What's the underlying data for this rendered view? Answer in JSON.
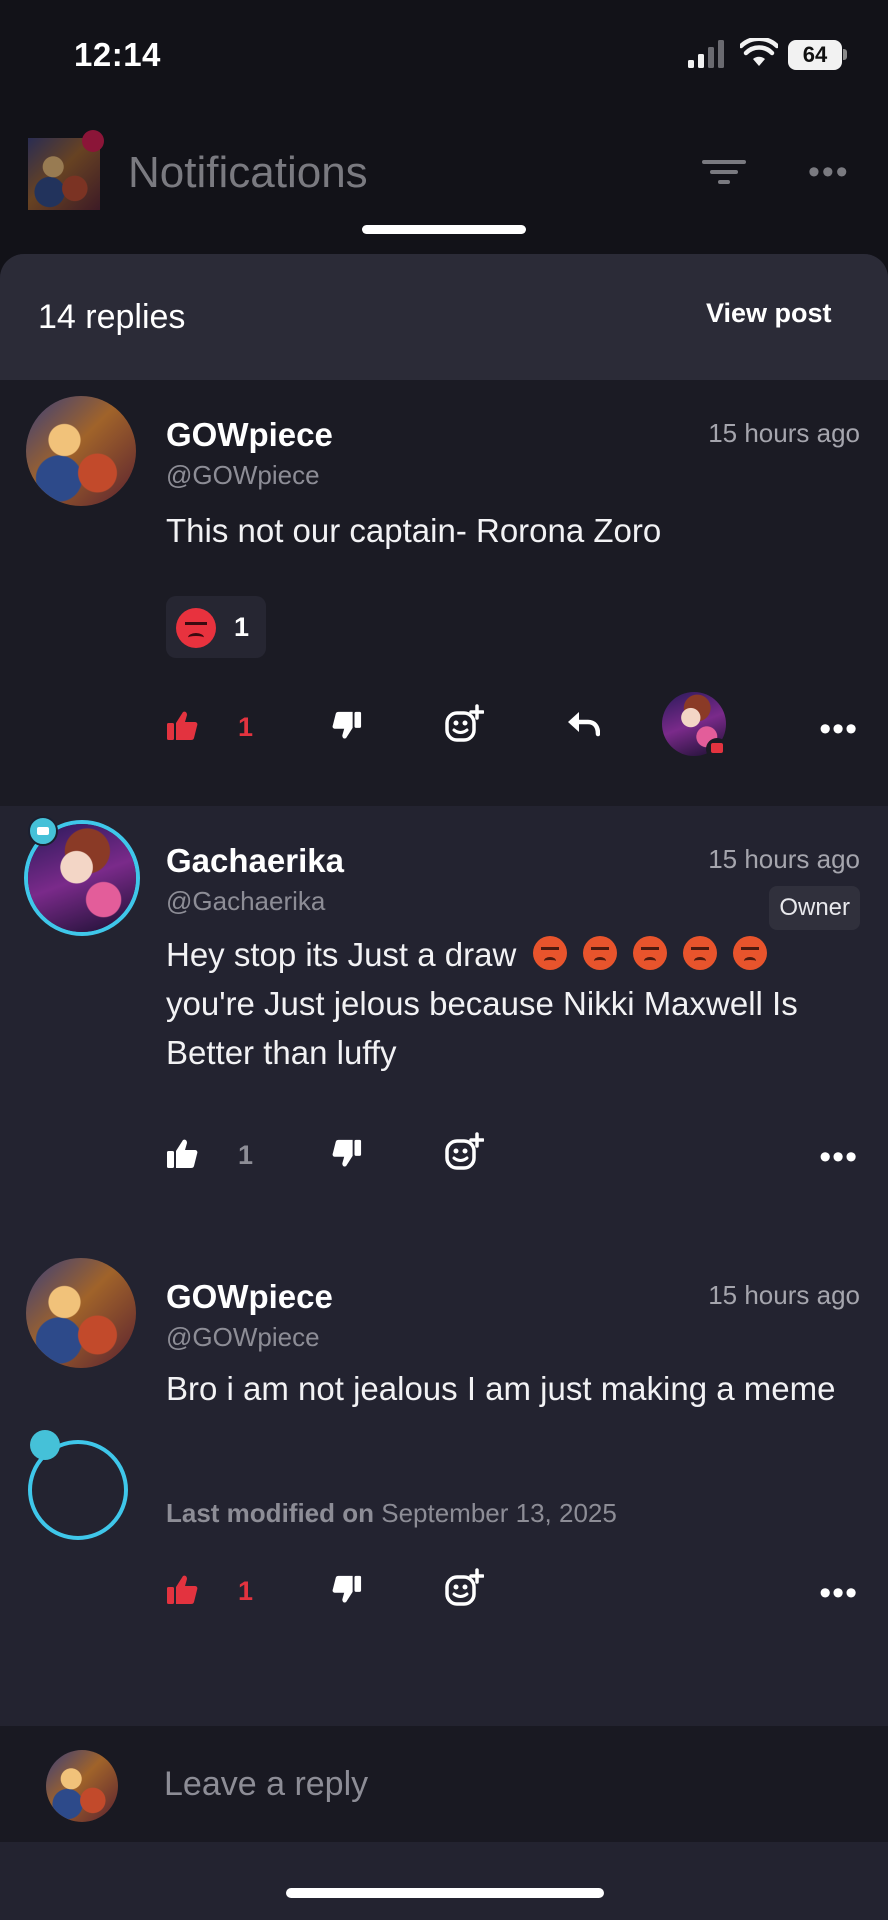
{
  "status_bar": {
    "time": "12:14",
    "battery": "64"
  },
  "background_header": {
    "title": "Notifications"
  },
  "sheet": {
    "reply_count": "14 replies",
    "view_post_label": "View post"
  },
  "comments": [
    {
      "author": "GOWpiece",
      "handle": "@GOWpiece",
      "time": "15 hours ago",
      "body": "This not our captain- Rorona Zoro",
      "reaction_count": "1",
      "like_count": "1",
      "liked": true
    },
    {
      "author": "Gachaerika",
      "handle": "@Gachaerika",
      "time": "15 hours ago",
      "badge": "Owner",
      "body_start": "Hey stop its Just a draw",
      "body_end": "you're Just jelous because Nikki Maxwell Is Better than luffy",
      "like_count": "1",
      "liked": false
    },
    {
      "author": "GOWpiece",
      "handle": "@GOWpiece",
      "time": "15 hours ago",
      "body": "Bro i am not jealous I am just making a meme",
      "modified_label": "Last modified on",
      "modified_date": "September 13, 2025",
      "like_count": "1",
      "liked": true
    }
  ],
  "reply_bar": {
    "placeholder": "Leave a reply"
  },
  "colors": {
    "accent_red": "#e3333f",
    "sheet_bg": "#232330",
    "ring_cyan": "#3fc7ea"
  },
  "icons": [
    "thumbs-up-icon",
    "thumbs-down-icon",
    "add-emoji-icon",
    "reply-icon",
    "more-icon",
    "filter-icon",
    "wifi-icon",
    "signal-icon"
  ]
}
